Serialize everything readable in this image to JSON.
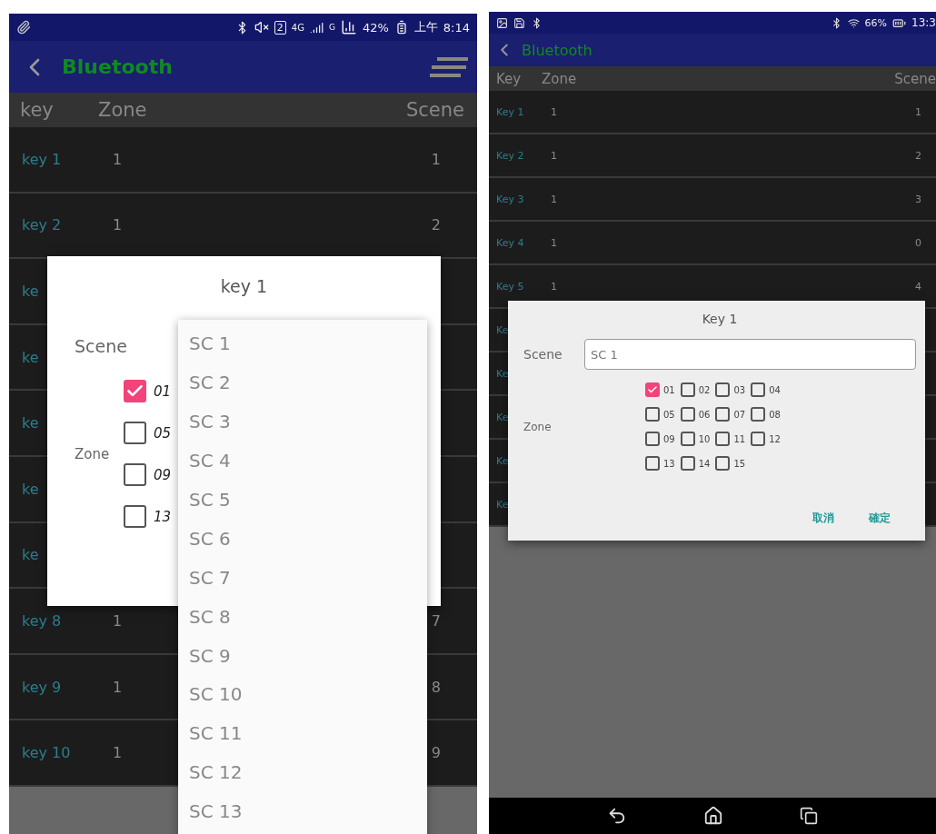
{
  "left_screen": {
    "status_bar": {
      "sim_slot": "2",
      "network": "4G",
      "roaming": "G",
      "battery": "42%",
      "period": "上午",
      "time": "8:14"
    },
    "app_bar": {
      "title": "Bluetooth"
    },
    "table": {
      "columns": [
        "key",
        "Zone",
        "Scene"
      ],
      "rows": [
        {
          "key": "key 1",
          "zone": "1",
          "scene": "1"
        },
        {
          "key": "key 2",
          "zone": "1",
          "scene": "2"
        },
        {
          "key": "ke"
        },
        {
          "key": "ke"
        },
        {
          "key": "ke"
        },
        {
          "key": "ke"
        },
        {
          "key": "ke"
        },
        {
          "key": "key 8",
          "zone": "1",
          "scene": "7"
        },
        {
          "key": "key 9",
          "zone": "1",
          "scene": "8"
        },
        {
          "key": "key 10",
          "zone": "1",
          "scene": "9"
        }
      ]
    },
    "dialog": {
      "title": "key 1",
      "scene_label": "Scene",
      "zone_label": "Zone",
      "zones": [
        {
          "label": "01",
          "checked": true
        },
        {
          "label": "05",
          "checked": false
        },
        {
          "label": "09",
          "checked": false
        },
        {
          "label": "13",
          "checked": false
        }
      ]
    },
    "dropdown": {
      "items": [
        "SC 1",
        "SC 2",
        "SC 3",
        "SC 4",
        "SC 5",
        "SC 6",
        "SC 7",
        "SC 8",
        "SC 9",
        "SC 10",
        "SC 11",
        "SC 12",
        "SC 13"
      ]
    }
  },
  "right_screen": {
    "status_bar": {
      "battery": "66%",
      "time": "13:3"
    },
    "app_bar": {
      "title": "Bluetooth"
    },
    "table": {
      "columns": [
        "Key",
        "Zone",
        "Scene"
      ],
      "rows": [
        {
          "key": "Key 1",
          "zone": "1",
          "scene": "1"
        },
        {
          "key": "Key 2",
          "zone": "1",
          "scene": "2"
        },
        {
          "key": "Key 3",
          "zone": "1",
          "scene": "3"
        },
        {
          "key": "Key 4",
          "zone": "1",
          "scene": "0"
        },
        {
          "key": "Key 5",
          "zone": "1",
          "scene": "4"
        },
        {
          "key": "Ke"
        },
        {
          "key": "Ke"
        },
        {
          "key": "Ke"
        },
        {
          "key": "Ke"
        },
        {
          "key": "Ke"
        }
      ]
    },
    "dialog": {
      "title": "Key 1",
      "scene_label": "Scene",
      "scene_value": "SC 1",
      "zone_label": "Zone",
      "zones": [
        {
          "label": "01",
          "checked": true
        },
        {
          "label": "02",
          "checked": false
        },
        {
          "label": "03",
          "checked": false
        },
        {
          "label": "04",
          "checked": false
        },
        {
          "label": "05",
          "checked": false
        },
        {
          "label": "06",
          "checked": false
        },
        {
          "label": "07",
          "checked": false
        },
        {
          "label": "08",
          "checked": false
        },
        {
          "label": "09",
          "checked": false
        },
        {
          "label": "10",
          "checked": false
        },
        {
          "label": "11",
          "checked": false
        },
        {
          "label": "12",
          "checked": false
        },
        {
          "label": "13",
          "checked": false
        },
        {
          "label": "14",
          "checked": false
        },
        {
          "label": "15",
          "checked": false
        }
      ],
      "buttons": [
        "取消",
        "確定"
      ]
    }
  }
}
